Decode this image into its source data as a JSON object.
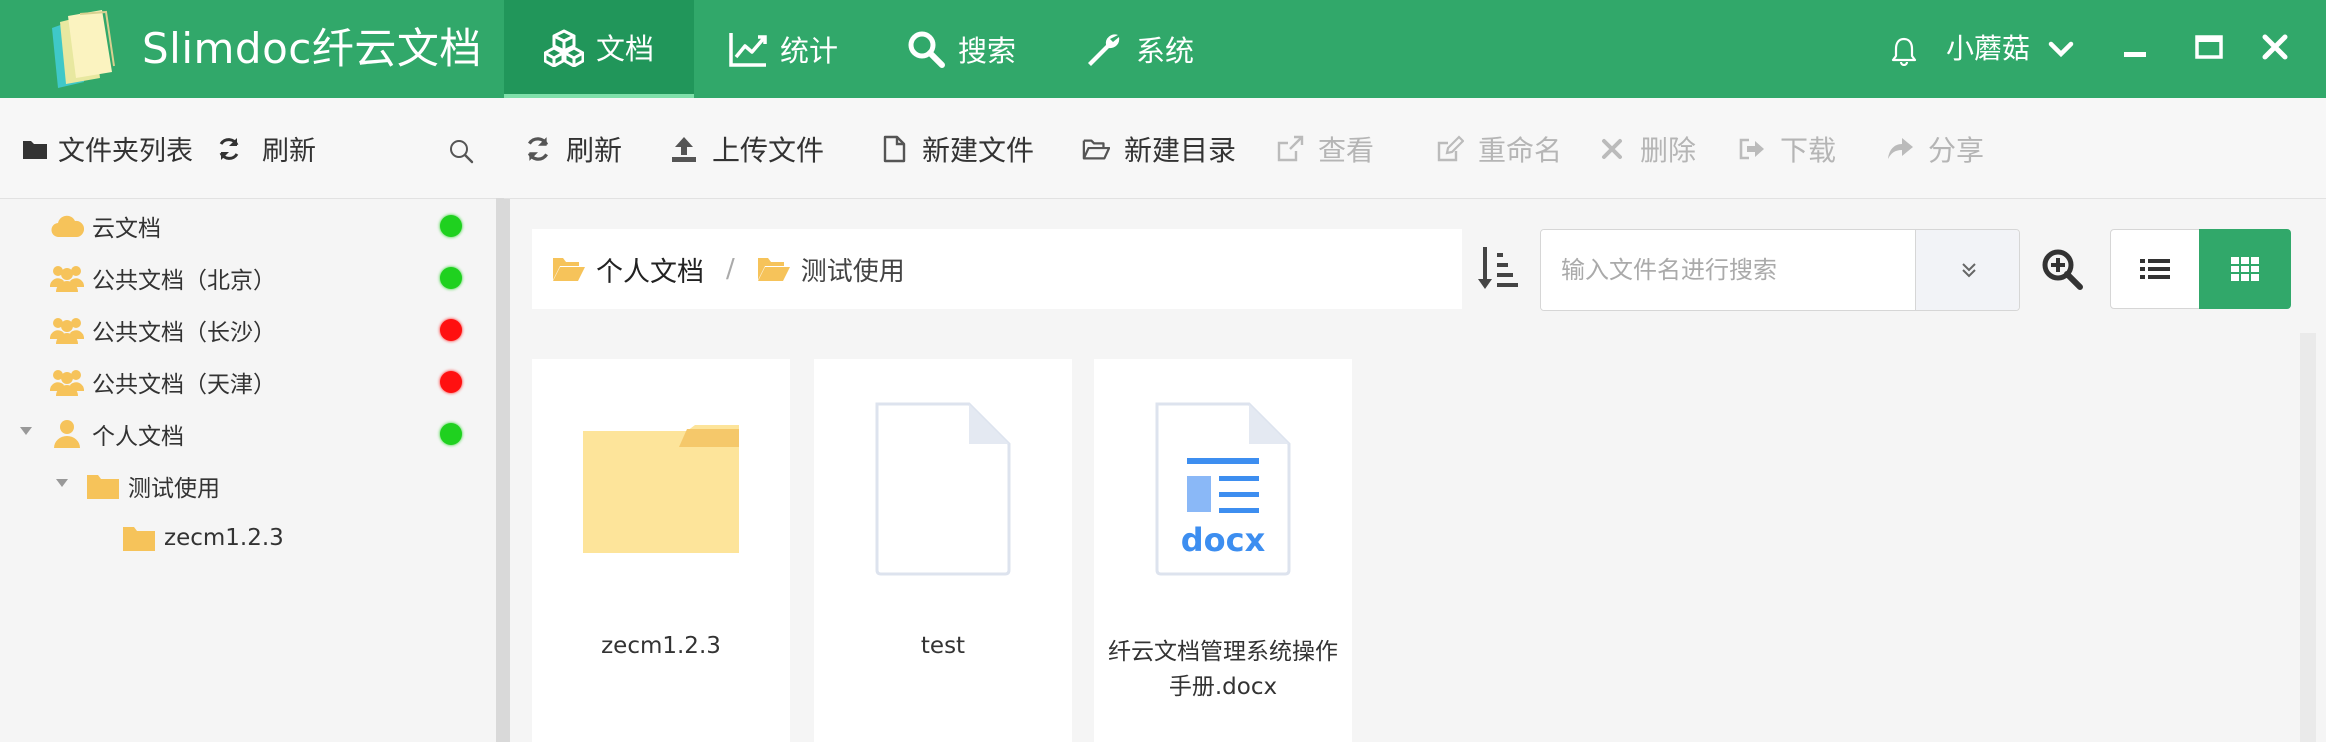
{
  "app": {
    "brand": "Slimdoc纤云文档",
    "accent": "#31a86a",
    "accent_dark": "#21965a"
  },
  "nav": [
    {
      "label": "文档",
      "icon": "cubes-icon",
      "active": true
    },
    {
      "label": "统计",
      "icon": "line-chart-icon",
      "active": false
    },
    {
      "label": "搜索",
      "icon": "search-icon",
      "active": false
    },
    {
      "label": "系统",
      "icon": "wrench-icon",
      "active": false
    }
  ],
  "user": {
    "name": "小蘑菇"
  },
  "sidebar": {
    "title": "文件夹列表",
    "refresh": "刷新",
    "tree": [
      {
        "label": "云文档",
        "icon": "cloud-icon",
        "status": "online",
        "level": 0
      },
      {
        "label": "公共文档（北京）",
        "icon": "users-icon",
        "status": "online",
        "level": 0
      },
      {
        "label": "公共文档（长沙）",
        "icon": "users-icon",
        "status": "offline",
        "level": 0
      },
      {
        "label": "公共文档（天津）",
        "icon": "users-icon",
        "status": "offline",
        "level": 0
      },
      {
        "label": "个人文档",
        "icon": "user-icon",
        "status": "online",
        "level": 0,
        "expanded": true
      },
      {
        "label": "测试使用",
        "icon": "folder-icon",
        "level": 1,
        "expanded": true
      },
      {
        "label": "zecm1.2.3",
        "icon": "folder-icon",
        "level": 2
      }
    ],
    "status_colors": {
      "online": "#1fd11f",
      "offline": "#ff1010"
    }
  },
  "toolbar": {
    "refresh": "刷新",
    "upload": "上传文件",
    "new_file": "新建文件",
    "new_dir": "新建目录",
    "view": "查看",
    "rename": "重命名",
    "delete": "删除",
    "download": "下载",
    "share": "分享"
  },
  "breadcrumb": [
    {
      "label": "个人文档"
    },
    {
      "label": "测试使用"
    }
  ],
  "breadcrumb_sep": "/",
  "search": {
    "placeholder": "输入文件名进行搜索"
  },
  "files": [
    {
      "name": "zecm1.2.3",
      "type": "folder"
    },
    {
      "name": "test",
      "type": "file"
    },
    {
      "name": "纤云文档管理系统操作手册.docx",
      "type": "docx",
      "badge": "docx"
    }
  ]
}
